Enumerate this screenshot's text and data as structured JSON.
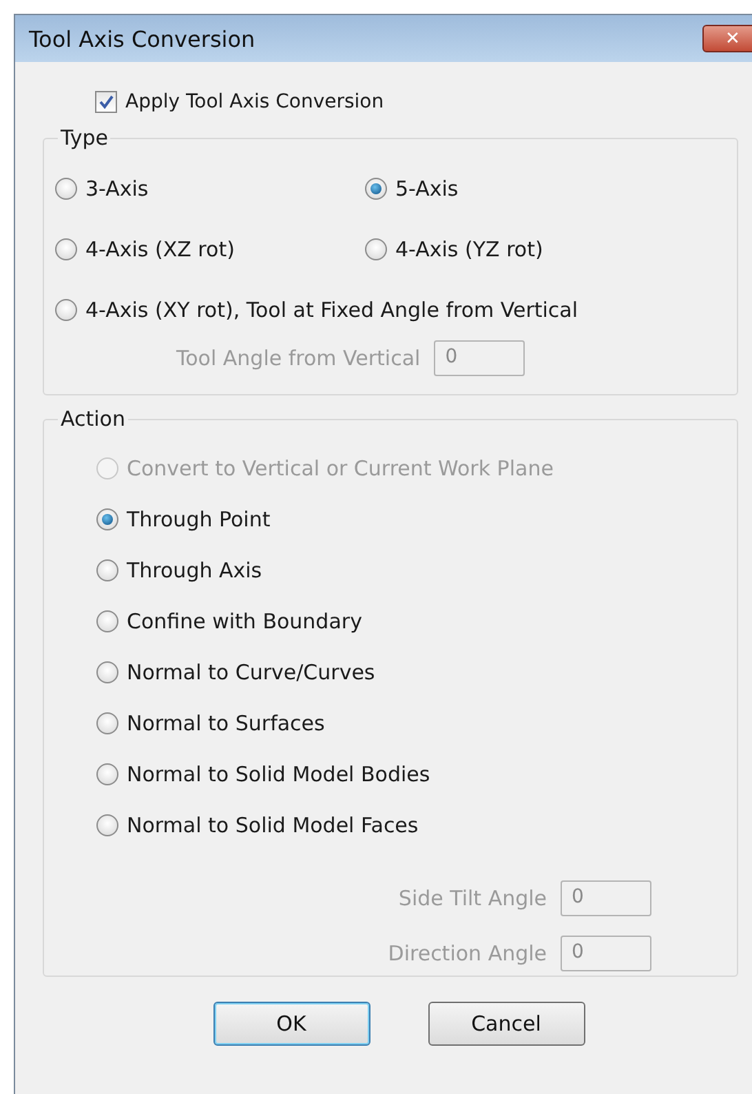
{
  "window": {
    "title": "Tool Axis Conversion",
    "close": "✕"
  },
  "apply": {
    "label": "Apply Tool Axis Conversion",
    "checked": true
  },
  "type": {
    "title": "Type",
    "options": [
      {
        "label": "3-Axis",
        "selected": false
      },
      {
        "label": "5-Axis",
        "selected": true
      },
      {
        "label": "4-Axis (XZ rot)",
        "selected": false
      },
      {
        "label": "4-Axis (YZ rot)",
        "selected": false
      },
      {
        "label": "4-Axis (XY rot), Tool at Fixed Angle from Vertical",
        "selected": false
      }
    ],
    "fields": [
      {
        "label": "Tool Angle from Vertical",
        "value": "0",
        "disabled": true
      }
    ]
  },
  "action": {
    "title": "Action",
    "options": [
      {
        "label": "Convert to Vertical or Current Work Plane",
        "selected": false,
        "disabled": true
      },
      {
        "label": "Through Point",
        "selected": true,
        "disabled": false
      },
      {
        "label": "Through Axis",
        "selected": false,
        "disabled": false
      },
      {
        "label": "Confine with Boundary",
        "selected": false,
        "disabled": false
      },
      {
        "label": "Normal to Curve/Curves",
        "selected": false,
        "disabled": false
      },
      {
        "label": "Normal to Surfaces",
        "selected": false,
        "disabled": false
      },
      {
        "label": "Normal to Solid Model Bodies",
        "selected": false,
        "disabled": false
      },
      {
        "label": "Normal to Solid Model Faces",
        "selected": false,
        "disabled": false
      }
    ],
    "fields": [
      {
        "label": "Side Tilt Angle",
        "value": "0",
        "disabled": true
      },
      {
        "label": "Direction Angle",
        "value": "0",
        "disabled": true
      }
    ]
  },
  "buttons": [
    {
      "label": "OK",
      "default": true
    },
    {
      "label": "Cancel",
      "default": false
    }
  ]
}
